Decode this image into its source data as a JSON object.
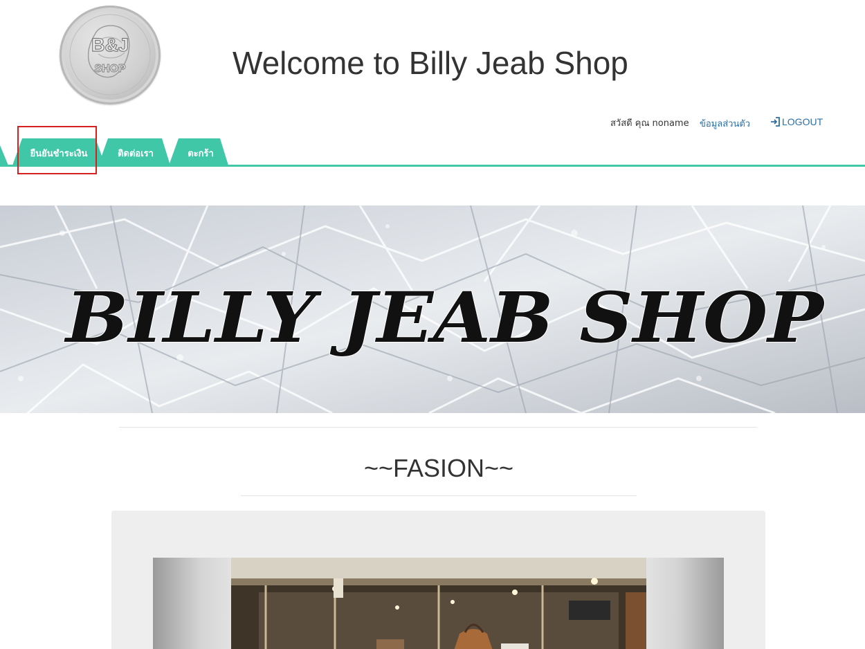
{
  "header": {
    "logo_alt": "B&J SHOP",
    "title": "Welcome to Billy Jeab Shop"
  },
  "userbar": {
    "greeting": "สวัสดี คุณ",
    "username": "noname",
    "profile_link": "ข้อมูลส่วนตัว",
    "logout_label": "LOGOUT",
    "logout_icon": "sign-in-icon"
  },
  "nav": {
    "tabs": [
      {
        "label": "ยืนยันชำระเงิน"
      },
      {
        "label": "ติดต่อเรา"
      },
      {
        "label": "ตะกร้า"
      }
    ],
    "accent_color": "#3fc7a8",
    "highlight_color": "#d62020"
  },
  "banner": {
    "text": "BILLY JEAB SHOP"
  },
  "section": {
    "title": "~~FASION~~"
  }
}
